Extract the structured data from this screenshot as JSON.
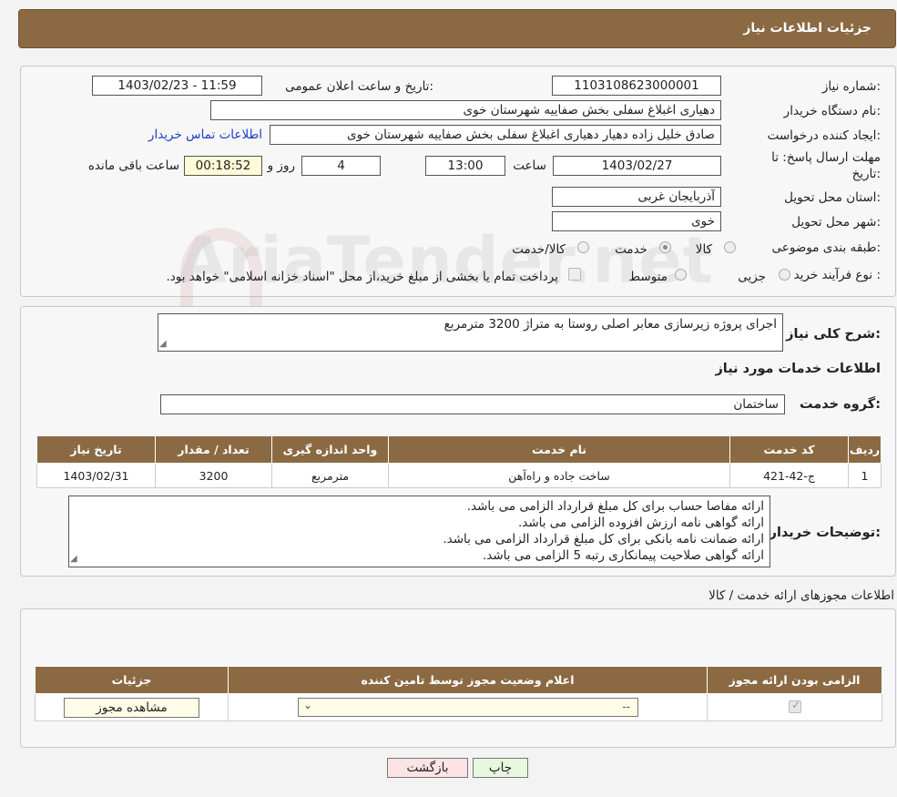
{
  "header": {
    "title": "جزئیات اطلاعات نیاز"
  },
  "watermark": "AriaTender.net",
  "form": {
    "need_number_label": "شماره نیاز:",
    "need_number": "1103108623000001",
    "announce_label": "تاریخ و ساعت اعلان عمومی:",
    "announce_value": "1403/02/23 - 11:59",
    "buyer_label": "نام دستگاه خریدار:",
    "buyer_value": "دهیاری اغبلاغ سفلی بخش صفاییه شهرستان خوی",
    "creator_label": "ایجاد کننده درخواست:",
    "creator_value": "صادق خلیل زاده دهیار دهیاری اغبلاغ سفلی بخش صفاییه شهرستان خوی",
    "contact_link": "اطلاعات تماس خریدار",
    "deadline_label_1": "مهلت ارسال پاسخ: تا",
    "deadline_label_2": "تاریخ:",
    "deadline_date": "1403/02/27",
    "time_label": "ساعت",
    "deadline_time": "13:00",
    "days_value": "4",
    "days_label": "روز و",
    "remaining_time": "00:18:52",
    "remaining_label": "ساعت باقی مانده",
    "province_label": "استان محل تحویل:",
    "province_value": "آذربایجان غربی",
    "city_label": "شهر محل تحویل:",
    "city_value": "خوی",
    "category_label": "طبقه بندی موضوعی:",
    "category_options": {
      "goods": "کالا",
      "service": "خدمت",
      "goods_service": "کالا/خدمت"
    },
    "purchase_label": "نوع فرآیند خرید :",
    "purchase_options": {
      "partial": "جزیی",
      "medium": "متوسط"
    },
    "payment_note": "پرداخت تمام یا بخشی از مبلغ خرید،از محل \"اسناد خزانه اسلامی\" خواهد بود."
  },
  "details": {
    "summary_label": "شرح کلی نیاز:",
    "summary_value": "اجرای پروژه زیرسازی معابر اصلی روستا به متراژ 3200 مترمربع",
    "services_title": "اطلاعات خدمات مورد نیاز",
    "service_group_label": "گروه خدمت:",
    "service_group_value": "ساختمان",
    "table": {
      "headers": [
        "ردیف",
        "کد خدمت",
        "نام خدمت",
        "واحد اندازه گیری",
        "تعداد / مقدار",
        "تاریخ نیاز"
      ],
      "rows": [
        [
          "1",
          "ج-42-421",
          "ساخت جاده و راه‌آهن",
          "مترمربع",
          "3200",
          "1403/02/31"
        ]
      ]
    },
    "buyer_notes_label": "توضیحات خریدار:",
    "buyer_notes": [
      "ارائه مفاصا حساب برای کل مبلغ قرارداد الزامی می باشد.",
      "ارائه گواهی نامه ارزش افزوده الزامی می باشد.",
      "ارائه ضمانت نامه بانکی برای کل مبلغ قرارداد الزامی می باشد.",
      "ارائه گواهی صلاحیت پیمانکاری رتبه 5 الزامی می باشد."
    ]
  },
  "permits": {
    "title": "اطلاعات مجوزهای ارائه خدمت / کالا",
    "headers": [
      "الزامی بودن ارائه مجوز",
      "اعلام وضعیت مجوز توسط تامین کننده",
      "جزئیات"
    ],
    "select_value": "--",
    "view_button": "مشاهده مجوز"
  },
  "buttons": {
    "print": "چاپ",
    "back": "بازگشت"
  },
  "colors": {
    "header_bg": "#8b6a43",
    "back_button": "#fbe3e6",
    "print_button": "#e8f7df",
    "remaining_bg": "#fffbd6",
    "link": "#1a3ec9"
  }
}
